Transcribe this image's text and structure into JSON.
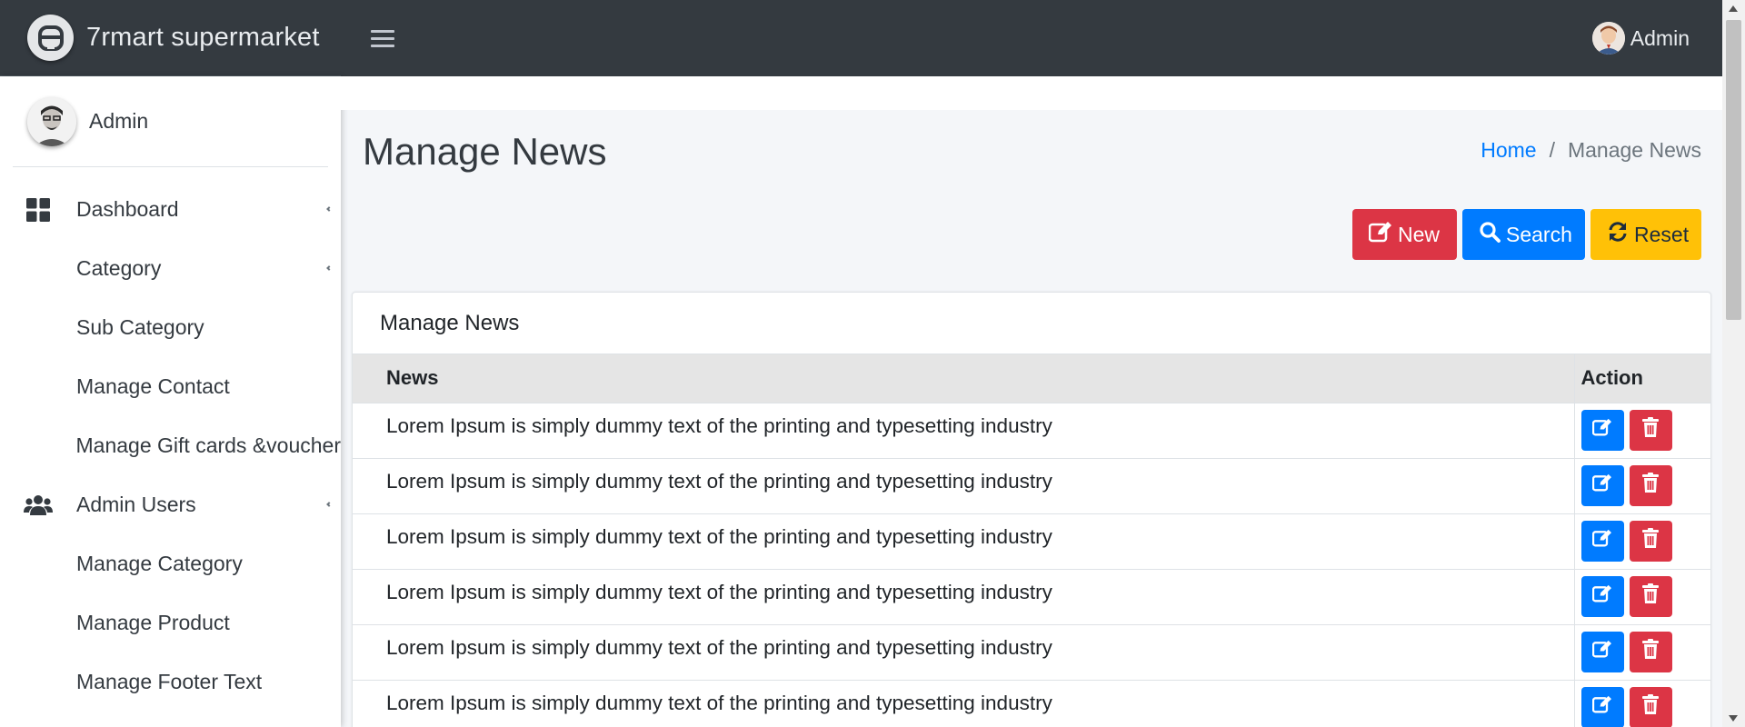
{
  "brand": {
    "name": "7rmart supermarket",
    "logo_icon": "brand-logo-icon"
  },
  "topbar": {
    "user_name": "Admin"
  },
  "sidebar": {
    "user_name": "Admin",
    "items": [
      {
        "label": "Dashboard",
        "icon": "dashboard-icon",
        "caret": true
      },
      {
        "label": "Category",
        "icon": "",
        "caret": true
      },
      {
        "label": "Sub Category",
        "icon": "",
        "caret": false
      },
      {
        "label": "Manage Contact",
        "icon": "",
        "caret": false
      },
      {
        "label": "Manage Gift cards &voucher",
        "icon": "",
        "caret": false
      },
      {
        "label": "Admin Users",
        "icon": "users-icon",
        "caret": true
      },
      {
        "label": "Manage Category",
        "icon": "",
        "caret": false
      },
      {
        "label": "Manage Product",
        "icon": "",
        "caret": false
      },
      {
        "label": "Manage Footer Text",
        "icon": "",
        "caret": false
      }
    ]
  },
  "page": {
    "title": "Manage News",
    "breadcrumb": {
      "home": "Home",
      "separator": "/",
      "current": "Manage News"
    }
  },
  "actions": {
    "new_label": "New",
    "search_label": "Search",
    "reset_label": "Reset"
  },
  "card": {
    "title": "Manage News",
    "columns": {
      "news": "News",
      "action": "Action"
    },
    "rows": [
      "Lorem Ipsum is simply dummy text of the printing and typesetting industry",
      "Lorem Ipsum is simply dummy text of the printing and typesetting industry",
      "Lorem Ipsum is simply dummy text of the printing and typesetting industry",
      "Lorem Ipsum is simply dummy text of the printing and typesetting industry",
      "Lorem Ipsum is simply dummy text of the printing and typesetting industry",
      "Lorem Ipsum is simply dummy text of the printing and typesetting industry"
    ]
  },
  "colors": {
    "navbar": "#343a40",
    "primary": "#007bff",
    "danger": "#dc3545",
    "warning": "#ffc107"
  }
}
